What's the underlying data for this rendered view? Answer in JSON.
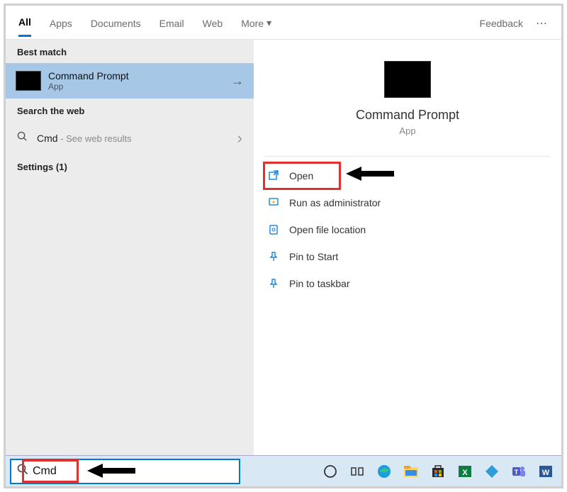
{
  "tabs": {
    "all": "All",
    "apps": "Apps",
    "documents": "Documents",
    "email": "Email",
    "web": "Web",
    "more": "More"
  },
  "feedback": "Feedback",
  "left": {
    "best_match_label": "Best match",
    "best_match": {
      "title": "Command Prompt",
      "subtitle": "App"
    },
    "search_web_label": "Search the web",
    "web_result": {
      "term": "Cmd",
      "hint": " - See web results"
    },
    "settings_label": "Settings (1)"
  },
  "right": {
    "title": "Command Prompt",
    "subtitle": "App",
    "actions": {
      "open": "Open",
      "run_admin": "Run as administrator",
      "open_location": "Open file location",
      "pin_start": "Pin to Start",
      "pin_taskbar": "Pin to taskbar"
    }
  },
  "search": {
    "value": "Cmd"
  }
}
